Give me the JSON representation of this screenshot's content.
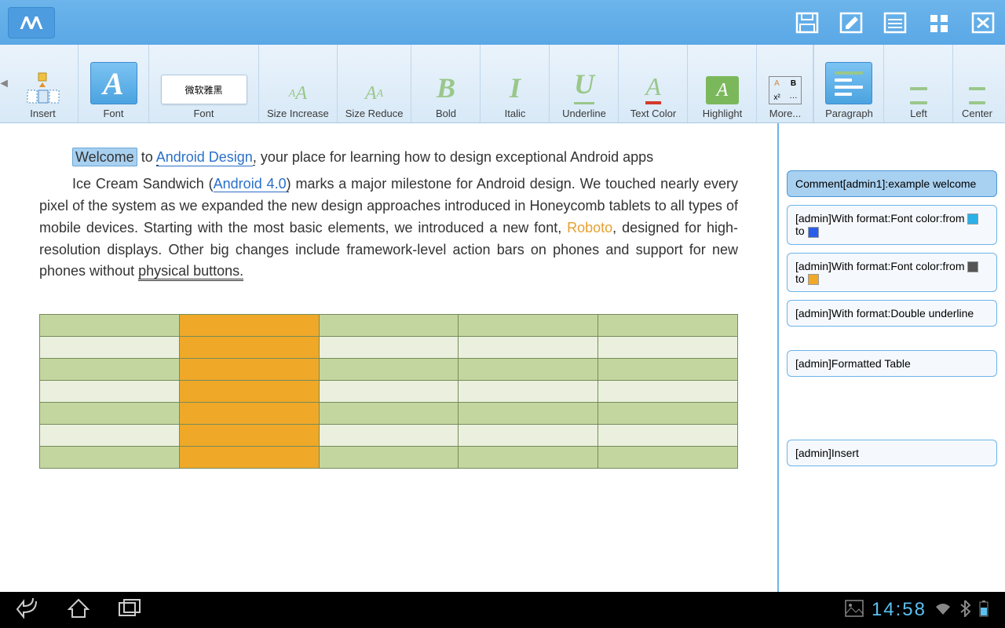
{
  "ribbon_tabs": {
    "insert": "Insert",
    "font_tab": "Font",
    "font_group": "Font",
    "font_selector": "微软雅黑",
    "size_increase": "Size Increase",
    "size_reduce": "Size Reduce",
    "bold": "Bold",
    "italic": "Italic",
    "underline": "Underline",
    "text_color": "Text Color",
    "highlight": "Highlight",
    "more": "More...",
    "paragraph": "Paragraph",
    "left": "Left",
    "center": "Center"
  },
  "document": {
    "welcome": "Welcome",
    "to": " to ",
    "android_design": "Android Design",
    "intro_rest": ", your place for learning how to design exceptional Android apps",
    "para2_pre": "Ice Cream Sandwich (",
    "android40": "Android 4.0",
    "para2_mid": ") marks a major milestone for Android design.",
    "para2_body": " We touched nearly every pixel of the system as we expanded the new design approaches introduced in Honeycomb tablets to all types of mobile devices. Starting with the most basic elements, we introduced a new font, ",
    "roboto": "Roboto",
    "para2_after_roboto": ", designed for high-resolution displays. Other big changes include framework-level action bars on phones and support for new phones without ",
    "physical_buttons": "physical buttons."
  },
  "comments": [
    {
      "text": "Comment[admin1]:example welcome"
    },
    {
      "text_pre": "[admin]With format:Font color:from ",
      "swatch1": "#2ab0e8",
      "mid": " to ",
      "swatch2": "#2a5ee8"
    },
    {
      "text_pre": "[admin]With format:Font color:from ",
      "swatch1": "#555555",
      "mid": " to ",
      "swatch2": "#f0a828"
    },
    {
      "text": "[admin]With format:Double underline"
    },
    {
      "text": "[admin]Formatted Table"
    },
    {
      "text": "[admin]Insert"
    }
  ],
  "statusbar": {
    "time": "14:58"
  }
}
